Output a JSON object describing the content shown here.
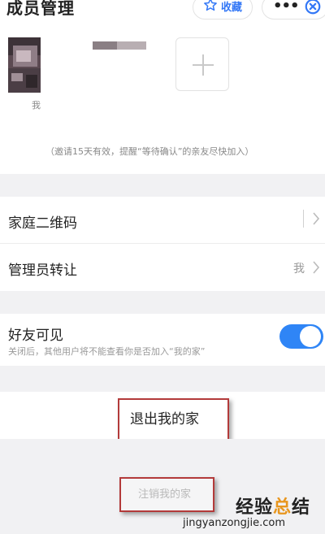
{
  "header": {
    "title": "成员管理",
    "favorite_label": "收藏",
    "more_label": "•••"
  },
  "members": {
    "me_label": "我",
    "invite_note": "（邀请15天有效，提醒“等待确认”的亲友尽快加入）"
  },
  "settings": {
    "qr_label": "家庭二维码",
    "admin_label": "管理员转让",
    "admin_value": "我",
    "friends_label": "好友可见",
    "friends_desc": "关闭后，其他用户将不能查看你是否加入“我的家”",
    "friends_visible": true
  },
  "actions": {
    "exit_label": "退出我的家",
    "cancel_label": "注销我的家"
  },
  "watermark": {
    "text_main": "经验",
    "text_highlight": "总",
    "text_end": "结",
    "url": "jingyanzongjie.com"
  },
  "colors": {
    "accent": "#2f85f6",
    "highlight_box": "#b33a3a",
    "section_bg": "#f1f1f3"
  }
}
